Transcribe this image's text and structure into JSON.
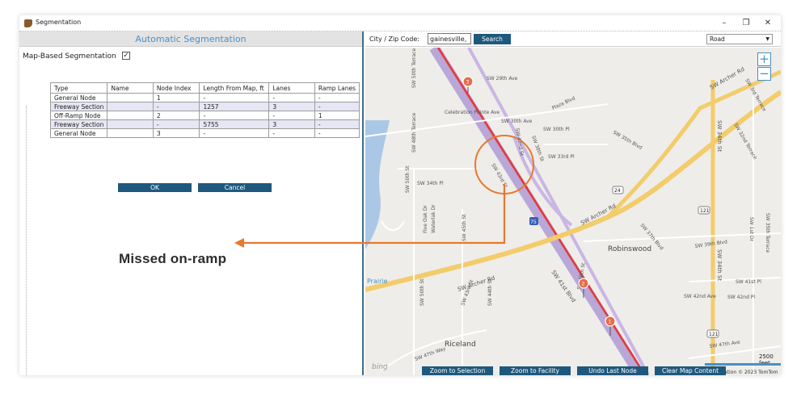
{
  "window": {
    "title": "Segmentation",
    "minimize": "–",
    "maximize": "❐",
    "close": "✕"
  },
  "left_panel": {
    "header": "Automatic Segmentation",
    "map_based_label": "Map-Based Segmentation",
    "map_based_checked": "✓",
    "table": {
      "headers": [
        "Type",
        "Name",
        "Node Index",
        "Length From Map, ft",
        "Lanes",
        "Ramp Lanes"
      ],
      "rows": [
        [
          "General Node",
          "",
          "1",
          "-",
          "-",
          "-"
        ],
        [
          "Freeway Section",
          "",
          "-",
          "1257",
          "3",
          "-"
        ],
        [
          "Off-Ramp Node",
          "",
          "2",
          "-",
          "-",
          "1"
        ],
        [
          "Freeway Section",
          "",
          "-",
          "5755",
          "3",
          "-"
        ],
        [
          "General Node",
          "",
          "3",
          "-",
          "-",
          "-"
        ]
      ]
    },
    "ok_label": "OK",
    "cancel_label": "Cancel"
  },
  "annotation": {
    "text": "Missed on-ramp",
    "color": "#e8782c"
  },
  "map_panel": {
    "city_label": "City / Zip Code:",
    "city_value": "gainesville, fl",
    "search_label": "Search",
    "view_select": "Road",
    "zoom_in": "+",
    "zoom_out": "−",
    "scale": "2500 feet",
    "attribution": "ation  © 2023 TomTom",
    "bing": "bing",
    "buttons": [
      "Zoom to Selection",
      "Zoom to Facility",
      "Undo Last Node",
      "Clear Map Content"
    ],
    "markers": [
      "3",
      "2",
      "1"
    ],
    "labels": {
      "sw29": "SW 29th Ave",
      "celebration": "Celebration Pointe Ave",
      "sw30ave": "SW 30th Ave",
      "sw30pl": "SW 30th Pl",
      "sw33pl": "SW 33rd Pl",
      "sw34pl": "SW 34th Pl",
      "plaza": "Plaza Blvd",
      "sw35": "SW 35th Blvd",
      "archer1": "SW Archer Rd",
      "archer2": "SW Archer Rd",
      "archer3": "SW Archer Rd",
      "robinswood": "Robinswood",
      "riceland": "Riceland",
      "prairie": "Prairie",
      "sw39": "SW 39th Blvd",
      "sw41pl": "SW 41st Pl",
      "sw42": "SW 42nd Ave",
      "sw42pl": "SW 42nd Pl",
      "sw47": "SW 47th Way",
      "sw47ave": "SW 47th Ave",
      "sw41blvd": "SW 41st Blvd",
      "sw34st": "SW 34th St",
      "sw3rdtr": "SW 3rd Terrace",
      "sw32": "SW 32nd Terrace",
      "sw50": "SW 50th Terrace",
      "sw48": "SW 48th Terrace",
      "sw43": "SW 43rd St",
      "sw42st": "SW 42nd St",
      "sw40": "SW 40th St",
      "sw45": "SW 45th St",
      "sw50st": "SW 50th St",
      "sw44": "SW 44th St",
      "sw37": "SW 37th Blvd",
      "sw35th": "SW 35th Terrace",
      "sw1st": "SW 1st Dr",
      "r24": "24",
      "r121a": "121",
      "r121b": "121",
      "i75": "75",
      "oakdr": "Five Oak Dr",
      "waterdr": "Waterlak Dr",
      "sw43st2": "SW 43rd St",
      "sw38": "SW 38th St"
    }
  }
}
